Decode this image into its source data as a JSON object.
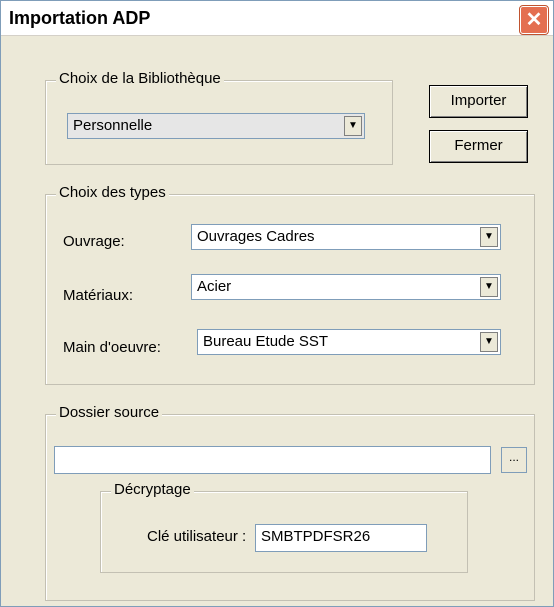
{
  "window": {
    "title": "Importation ADP",
    "close_glyph": "✕"
  },
  "bibliotheque": {
    "legend": "Choix de la Bibliothèque",
    "value": "Personnelle"
  },
  "buttons": {
    "importer": "Importer",
    "fermer": "Fermer"
  },
  "types": {
    "legend": "Choix des types",
    "rows": [
      {
        "label": "Ouvrage:",
        "value": "Ouvrages Cadres"
      },
      {
        "label": "Matériaux:",
        "value": "Acier"
      },
      {
        "label": "Main d'oeuvre:",
        "value": "Bureau Etude SST"
      }
    ]
  },
  "dossier": {
    "legend": "Dossier source",
    "path_value": "",
    "browse_label": "..."
  },
  "decryptage": {
    "legend": "Décryptage",
    "key_label": "Clé utilisateur :",
    "key_value": "SMBTPDFSR26"
  },
  "icons": {
    "dropdown": "▼"
  }
}
